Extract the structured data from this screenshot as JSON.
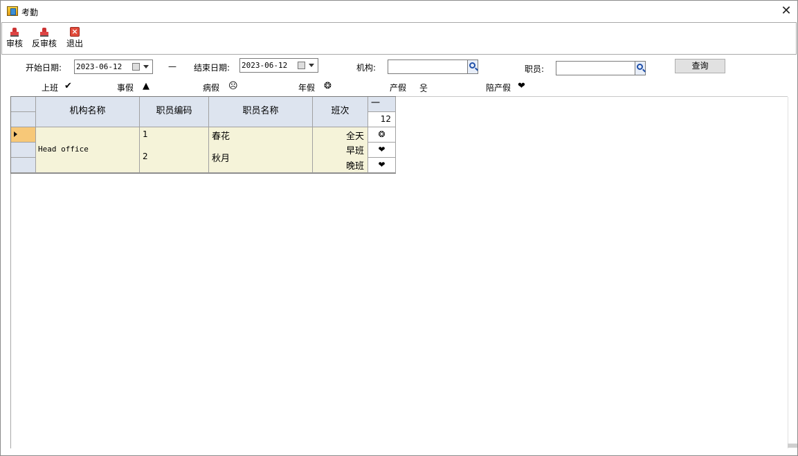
{
  "window": {
    "title": "考勤",
    "close_symbol": "✕"
  },
  "toolbar": {
    "approve_label": "审核",
    "unapprove_label": "反审核",
    "exit_label": "退出"
  },
  "filters": {
    "start_label": "开始日期:",
    "start_value": "2023-06-12",
    "dash": "—",
    "end_label": "结束日期:",
    "end_value": "2023-06-12",
    "org_label": "机构:",
    "org_value": "",
    "employee_label": "职员:",
    "employee_value": "",
    "query_label": "查询"
  },
  "legend": [
    {
      "label": "上班",
      "symbol": "✔"
    },
    {
      "label": "事假",
      "symbol": "▲"
    },
    {
      "label": "病假",
      "symbol": "☹"
    },
    {
      "label": "年假",
      "symbol": "❂"
    },
    {
      "label": "产假",
      "symbol": "웃"
    },
    {
      "label": "陪产假",
      "symbol": "❤"
    }
  ],
  "grid": {
    "headers": {
      "org": "机构名称",
      "emp_code": "职员编码",
      "emp_name": "职员名称",
      "shift": "班次",
      "weekday": "一",
      "day": "12"
    },
    "org_name": "Head office",
    "rows": [
      {
        "code": "1",
        "name": "春花",
        "shift": "全天",
        "mark": "❂"
      },
      {
        "code": "2",
        "name": "秋月",
        "shift": "早班",
        "mark": "❤"
      },
      {
        "shift": "晚班",
        "mark": "❤"
      }
    ]
  }
}
